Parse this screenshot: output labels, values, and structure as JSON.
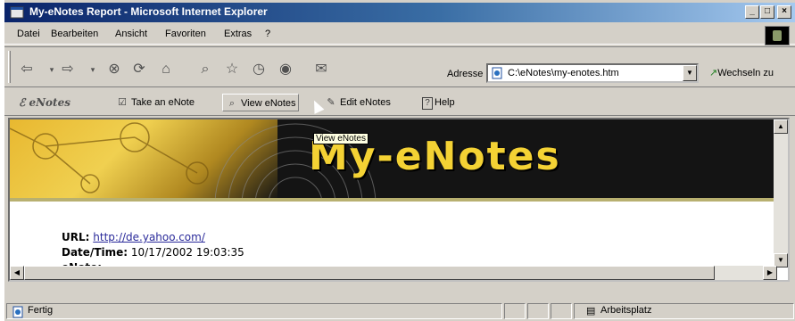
{
  "window": {
    "title": "My-eNotes Report - Microsoft Internet Explorer",
    "controls": {
      "minimize": "_",
      "maximize": "□",
      "close": "×"
    }
  },
  "menu": {
    "items": [
      {
        "label": "Datei"
      },
      {
        "label": "Bearbeiten"
      },
      {
        "label": "Ansicht"
      },
      {
        "label": "Favoriten"
      },
      {
        "label": "Extras"
      },
      {
        "label": "?"
      }
    ]
  },
  "toolbar": {
    "buttons": [
      {
        "icon": "back-icon",
        "glyph": "⇦"
      },
      {
        "icon": "forward-icon",
        "glyph": "⇨"
      },
      {
        "icon": "stop-icon",
        "glyph": "⊗"
      },
      {
        "icon": "refresh-icon",
        "glyph": "⟳"
      },
      {
        "icon": "home-icon",
        "glyph": "⌂"
      },
      {
        "icon": "search-icon",
        "glyph": "⌕"
      },
      {
        "icon": "favorites-icon",
        "glyph": "☆"
      },
      {
        "icon": "history-icon",
        "glyph": "◷"
      },
      {
        "icon": "media-icon",
        "glyph": "◉"
      },
      {
        "icon": "mail-icon",
        "glyph": "✉"
      }
    ],
    "address_label": "Adresse",
    "address_value": "C:\\eNotes\\my-enotes.htm",
    "go_label": "Wechseln zu"
  },
  "enotes_bar": {
    "logo": "eNotes",
    "buttons": [
      {
        "label": "Take an eNote",
        "icon": "check-note-icon",
        "glyph": "☑"
      },
      {
        "label": "View eNotes",
        "icon": "binoculars-icon",
        "glyph": "⌕"
      },
      {
        "label": "Edit eNotes",
        "icon": "edit-notes-icon",
        "glyph": "✎"
      },
      {
        "label": "Help",
        "icon": "help-icon",
        "glyph": "?"
      }
    ]
  },
  "tooltip": "View eNotes",
  "page": {
    "banner_title": "My-eNotes",
    "url_label": "URL:",
    "url_value": "http://de.yahoo.com/",
    "datetime_label": "Date/Time:",
    "datetime_value": "10/17/2002 19:03:35",
    "enote_label": "eNote:"
  },
  "status": {
    "left": "Fertig",
    "zone": "Arbeitsplatz"
  }
}
